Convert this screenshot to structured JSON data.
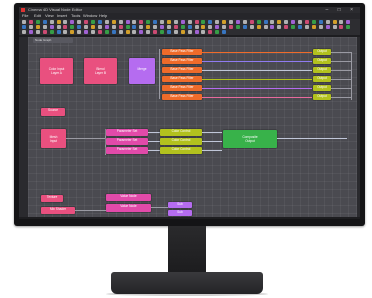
{
  "app": {
    "title": "Cinema 4D Visual Node Editor",
    "window_buttons": "– □ ×",
    "menu": [
      "File",
      "Edit",
      "View",
      "Insert",
      "Tools",
      "Window",
      "Help"
    ],
    "tab_label": "Node Graph"
  },
  "colors": {
    "pink": "#e9507f",
    "magenta": "#e14aa9",
    "purple": "#b56cf0",
    "orange": "#ef6b2a",
    "olive": "#b2c11e",
    "green": "#38b24a"
  },
  "graph": {
    "top_nodes": {
      "pink_a": "Color Input\nLayer A",
      "pink_b": "Blend\nLayer B",
      "purple": "Merge"
    },
    "orange_nodes": [
      "Base Pass Filter",
      "Base Pass Filter",
      "Base Pass Filter",
      "Base Pass Filter",
      "Base Pass Filter",
      "Base Pass Filter"
    ],
    "olive_outputs": [
      "Output",
      "Output",
      "Output",
      "Output",
      "Output",
      "Output"
    ],
    "mid_small": "Source",
    "mid_pink": "Mesh\nInput",
    "magenta_chain": [
      "Parameter Set",
      "Parameter Set",
      "Parameter Set"
    ],
    "olive_mid": [
      "Color Control",
      "Color Control",
      "Color Control"
    ],
    "green_node": "Composite\nOutput",
    "bottom_pink": [
      "Texture",
      "Mix Shader"
    ],
    "bottom_magenta": [
      "Value Node",
      "Value Node"
    ],
    "bottom_purple": [
      "Sub",
      "Sub"
    ]
  }
}
